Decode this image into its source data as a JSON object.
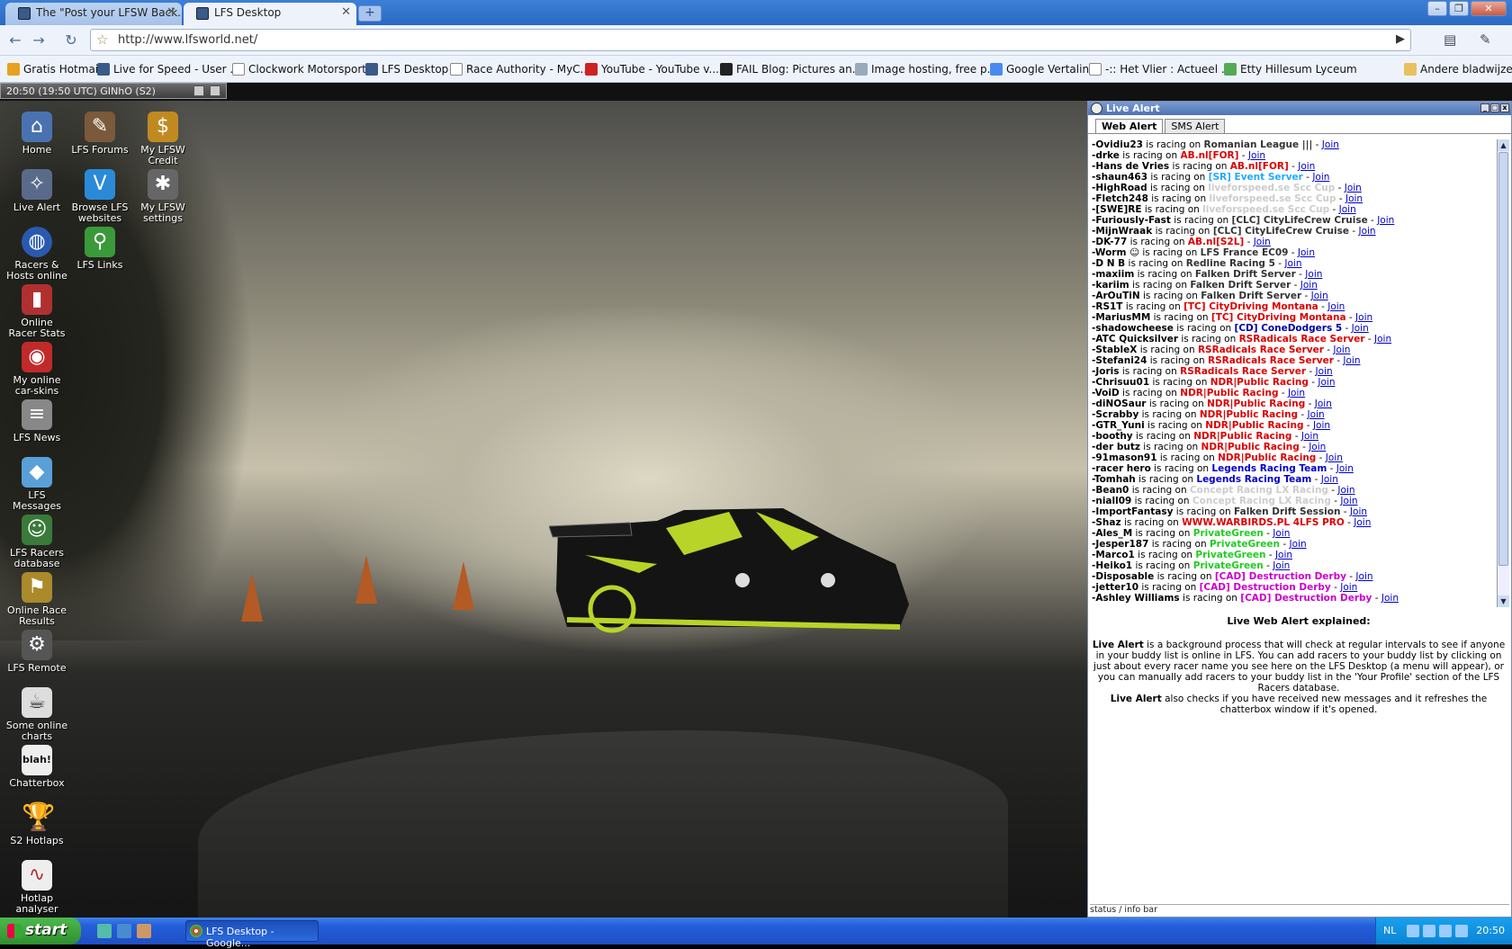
{
  "browser": {
    "tabs": [
      {
        "label": "The \"Post your LFSW Back..."
      },
      {
        "label": "LFS Desktop"
      }
    ],
    "url": "http://www.lfsworld.net/",
    "bookmarks": [
      "Gratis Hotmail",
      "Live for Speed - User ...",
      "Clockwork Motorsport...",
      "LFS Desktop",
      "Race Authority - MyC...",
      "YouTube - YouTube v...",
      "FAIL Blog: Pictures an...",
      "Image hosting, free p...",
      "Google Vertaling",
      "-:: Het Vlier : Actueel ...",
      "Etty Hillesum Lyceum"
    ],
    "other_bookmarks": "Andere bladwijzers"
  },
  "lfs_status": "20:50 (19:50 UTC)  GINhO (S2)",
  "desktop_icons": [
    {
      "label": "Home",
      "icon": "home-icon",
      "color": "#4a72b0"
    },
    {
      "label": "LFS Forums",
      "icon": "forums-icon",
      "color": "#7a5a3a"
    },
    {
      "label": "My LFSW Credit",
      "icon": "credit-icon",
      "color": "#c08a20"
    },
    {
      "label": "Live Alert",
      "icon": "live-alert-icon",
      "color": "#5a6a8a"
    },
    {
      "label": "Browse LFS websites",
      "icon": "browse-icon",
      "color": "#2a8ad8"
    },
    {
      "label": "My LFSW settings",
      "icon": "settings-icon",
      "color": "#666"
    },
    {
      "label": "Racers & Hosts online",
      "icon": "globe-icon",
      "color": "#2a5ab0"
    },
    {
      "label": "LFS Links",
      "icon": "links-icon",
      "color": "#3a9a3a"
    },
    {
      "label": "Online Racer Stats",
      "icon": "stats-icon",
      "color": "#b03030"
    },
    {
      "label": "My online car-skins",
      "icon": "car-skins-icon",
      "color": "#c02a2a"
    },
    {
      "label": "LFS News",
      "icon": "news-icon",
      "color": "#888"
    },
    {
      "label": "LFS Messages",
      "icon": "messages-icon",
      "color": "#5aa0d8"
    },
    {
      "label": "LFS Racers database",
      "icon": "database-icon",
      "color": "#3a7a3a"
    },
    {
      "label": "Online Race Results",
      "icon": "results-icon",
      "color": "#aa8a2a"
    },
    {
      "label": "LFS Remote",
      "icon": "remote-icon",
      "color": "#555"
    },
    {
      "label": "Some online charts",
      "icon": "charts-icon",
      "color": "#ddd"
    },
    {
      "label": "Chatterbox",
      "icon": "chatterbox-icon",
      "color": "#eee"
    },
    {
      "label": "S2 Hotlaps",
      "icon": "trophy-icon",
      "color": "#c8a020"
    },
    {
      "label": "Hotlap analyser",
      "icon": "analyser-icon",
      "color": "#b03030"
    }
  ],
  "live_alert": {
    "title": "Live Alert",
    "tabs": [
      "Web Alert",
      "SMS Alert"
    ],
    "join_label": "Join",
    "racing_on": "is racing on",
    "racers": [
      {
        "name": "-Ovidiu23",
        "server": "Romanian League |||",
        "color": "#333"
      },
      {
        "name": "-drke",
        "server": "AB.nl[FOR]",
        "color": "#d00"
      },
      {
        "name": "-Hans de Vries",
        "server": "AB.nl[FOR]",
        "color": "#d00"
      },
      {
        "name": "-shaun463",
        "server": "[SR] Event Server",
        "color": "#2af"
      },
      {
        "name": "-HighRoad",
        "server": "liveforspeed.se Scc Cup",
        "color": "#ccc"
      },
      {
        "name": "-Fletch248",
        "server": "liveforspeed.se Scc Cup",
        "color": "#ccc"
      },
      {
        "name": "-[SWE]RE",
        "server": "liveforspeed.se Scc Cup",
        "color": "#ccc"
      },
      {
        "name": "-Furiously-Fast",
        "server": "[CLC] CityLifeCrew Cruise",
        "color": "#333"
      },
      {
        "name": "-MijnWraak",
        "server": "[CLC] CityLifeCrew Cruise",
        "color": "#333"
      },
      {
        "name": "-DK-77",
        "server": "AB.nl[S2L]",
        "color": "#d00"
      },
      {
        "name": "-Worm ☺",
        "server": "LFS France EC09",
        "color": "#333"
      },
      {
        "name": "-D N B",
        "server": "Redline Racing 5",
        "color": "#333"
      },
      {
        "name": "-maxiim",
        "server": "Falken Drift Server",
        "color": "#333"
      },
      {
        "name": "-kariim",
        "server": "Falken Drift Server",
        "color": "#333"
      },
      {
        "name": "-ArOuTiN",
        "server": "Falken Drift Server",
        "color": "#333"
      },
      {
        "name": "-RS1T",
        "server": "[TC] CityDriving Montana",
        "color": "#d00"
      },
      {
        "name": "-MariusMM",
        "server": "[TC] CityDriving Montana",
        "color": "#d00"
      },
      {
        "name": "-shadowcheese",
        "server": "[CD] ConeDodgers 5",
        "color": "#00a"
      },
      {
        "name": "-ATC Quicksilver",
        "server": "RSRadicals Race Server",
        "color": "#d00"
      },
      {
        "name": "-StableX",
        "server": "RSRadicals Race Server",
        "color": "#d00"
      },
      {
        "name": "-Stefani24",
        "server": "RSRadicals Race Server",
        "color": "#d00"
      },
      {
        "name": "-Joris",
        "server": "RSRadicals Race Server",
        "color": "#d00"
      },
      {
        "name": "-Chrisuu01",
        "server": "NDR|Public Racing",
        "color": "#d00"
      },
      {
        "name": "-VoiD",
        "server": "NDR|Public Racing",
        "color": "#d00"
      },
      {
        "name": "-diNOSaur",
        "server": "NDR|Public Racing",
        "color": "#d00"
      },
      {
        "name": "-Scrabby",
        "server": "NDR|Public Racing",
        "color": "#d00"
      },
      {
        "name": "-GTR_Yuni",
        "server": "NDR|Public Racing",
        "color": "#d00"
      },
      {
        "name": "-boothy",
        "server": "NDR|Public Racing",
        "color": "#d00"
      },
      {
        "name": "-der butz",
        "server": "NDR|Public Racing",
        "color": "#d00"
      },
      {
        "name": "-91mason91",
        "server": "NDR|Public Racing",
        "color": "#d00"
      },
      {
        "name": "-racer hero",
        "server": "Legends Racing Team",
        "color": "#00c"
      },
      {
        "name": "-Tomhah",
        "server": "Legends Racing Team",
        "color": "#00c"
      },
      {
        "name": "-Bean0",
        "server": "Concept Racing LX Racing",
        "color": "#ccc"
      },
      {
        "name": "-niall09",
        "server": "Concept Racing LX Racing",
        "color": "#ccc"
      },
      {
        "name": "-ImportFantasy",
        "server": "Falken Drift Session",
        "color": "#333"
      },
      {
        "name": "-Shaz",
        "server": "WWW.WARBIRDS.PL 4LFS PRO",
        "color": "#d00"
      },
      {
        "name": "-Ales_M",
        "server": "PrivateGreen",
        "color": "#2c2"
      },
      {
        "name": "-Jesper187",
        "server": "PrivateGreen",
        "color": "#2c2"
      },
      {
        "name": "-Marco1",
        "server": "PrivateGreen",
        "color": "#2c2"
      },
      {
        "name": "-Heiko1",
        "server": "PrivateGreen",
        "color": "#2c2"
      },
      {
        "name": "-Disposable",
        "server": "[CAD] Destruction Derby",
        "color": "#c0c"
      },
      {
        "name": "-jetter10",
        "server": "[CAD] Destruction Derby",
        "color": "#c0c"
      },
      {
        "name": "-Ashley Williams",
        "server": "[CAD] Destruction Derby",
        "color": "#c0c"
      }
    ],
    "explain_title": "Live Web Alert explained:",
    "explain_p1_bold": "Live Alert",
    "explain_p1": "is a background process that will check at regular intervals to see if anyone in your buddy list is online in LFS. You can add racers to your buddy list by clicking on just about every racer name you see here on the LFS Desktop (a menu will appear), or you can manually add racers to your buddy list in the 'Your Profile' section of the LFS Racers database.",
    "explain_p2_bold": "Live Alert",
    "explain_p2": "also checks if you have received new messages and it refreshes the chatterbox window if it's opened.",
    "infobar": "status / info bar"
  },
  "taskbar": {
    "start": "start",
    "task": "LFS Desktop - Google...",
    "lang": "NL",
    "clock": "20:50"
  }
}
